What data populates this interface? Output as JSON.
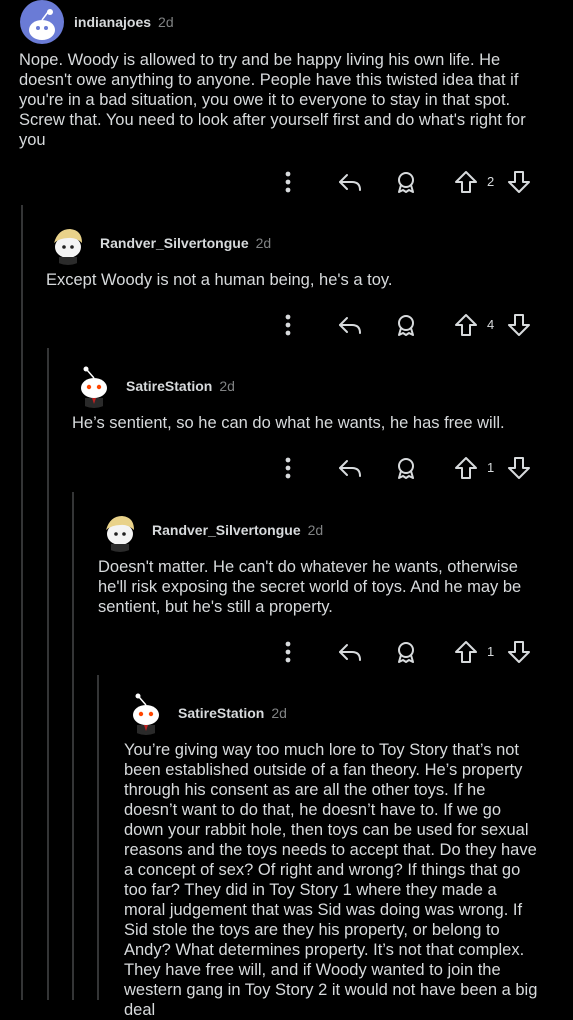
{
  "comments": [
    {
      "username": "indianajoes",
      "age": "2d",
      "body": "Nope. Woody is allowed to try and be happy living his own life. He doesn't owe anything to anyone. People have this twisted idea that if you're in a bad situation, you owe it to everyone to stay in that spot. Screw that. You need to look after yourself first and do what's right for you",
      "score": "2",
      "avatar": "snoo-blue-avatar"
    },
    {
      "username": "Randver_Silvertongue",
      "age": "2d",
      "body": "Except Woody is not a human being, he's a toy.",
      "score": "4",
      "avatar": "blonde-snoo-avatar"
    },
    {
      "username": "SatireStation",
      "age": "2d",
      "body": "He’s sentient, so he can do what he wants, he has free will.",
      "score": "1",
      "avatar": "snoo-suit-avatar"
    },
    {
      "username": "Randver_Silvertongue",
      "age": "2d",
      "body": "Doesn't matter. He can't do whatever he wants, otherwise he'll risk exposing the secret world of toys. And he may be sentient, but he's still a property.",
      "score": "1",
      "avatar": "blonde-snoo-avatar"
    },
    {
      "username": "SatireStation",
      "age": "2d",
      "body": "You’re giving way too much lore to Toy Story that’s not been established outside of a fan theory. He’s property through his consent as are all the other toys. If he doesn’t want to do that, he doesn’t have to. If we go down your rabbit hole, then toys can be used for sexual reasons and the toys needs to accept that. Do they have a concept of sex? Of right and wrong? If things that go too far? They did in Toy Story 1 where they made a moral judgement that was Sid was doing was wrong. If Sid stole the toys are they his property, or belong to Andy? What determines property. It’s not that complex. They have free will, and if Woody wanted to join the western gang in Toy Story 2 it would not have been a big deal",
      "avatar": "snoo-suit-avatar"
    }
  ],
  "icons": {
    "more": "more-options-icon",
    "reply": "reply-icon",
    "award": "award-icon",
    "upvote": "upvote-icon",
    "downvote": "downvote-icon"
  },
  "colors": {
    "background": "#000000",
    "text": "#d7dadc",
    "meta": "#818384",
    "thread_line": "#343536",
    "avatar_blue": "#6a7bd6"
  }
}
